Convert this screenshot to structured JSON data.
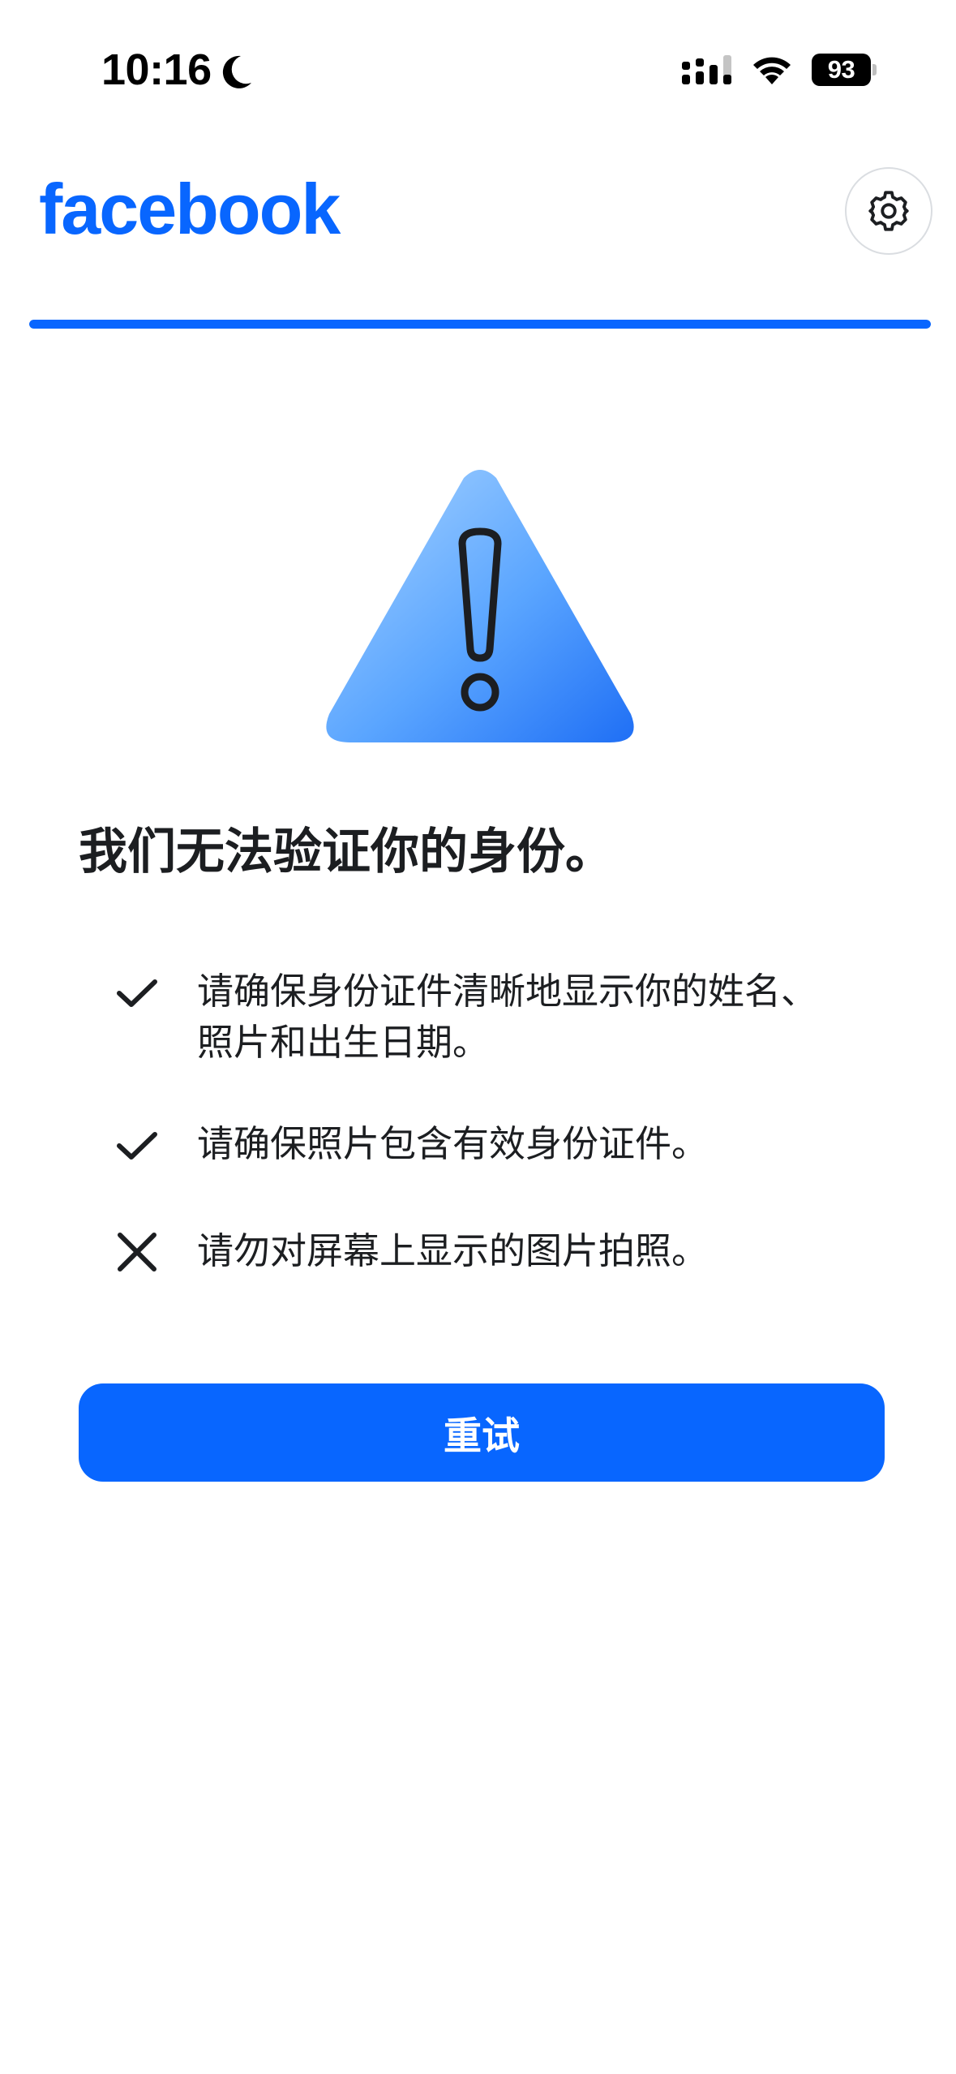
{
  "status_bar": {
    "time": "10:16",
    "battery_level": "93",
    "icons": [
      "moon-icon",
      "signal-icon",
      "wifi-icon",
      "battery-icon"
    ]
  },
  "header": {
    "logo_text": "facebook",
    "settings_icon": "gear-icon",
    "brand_color": "#0866ff",
    "progress_fraction": 1.0
  },
  "illustration": {
    "icon": "warning-triangle-icon"
  },
  "main": {
    "title": "我们无法验证你的身份。",
    "tips": [
      {
        "icon": "check-icon",
        "text": "请确保身份证件清晰地显示你的姓名、照片和出生日期。"
      },
      {
        "icon": "check-icon",
        "text": "请确保照片包含有效身份证件。"
      },
      {
        "icon": "close-icon",
        "text": "请勿对屏幕上显示的图片拍照。"
      }
    ],
    "retry_label": "重试"
  }
}
